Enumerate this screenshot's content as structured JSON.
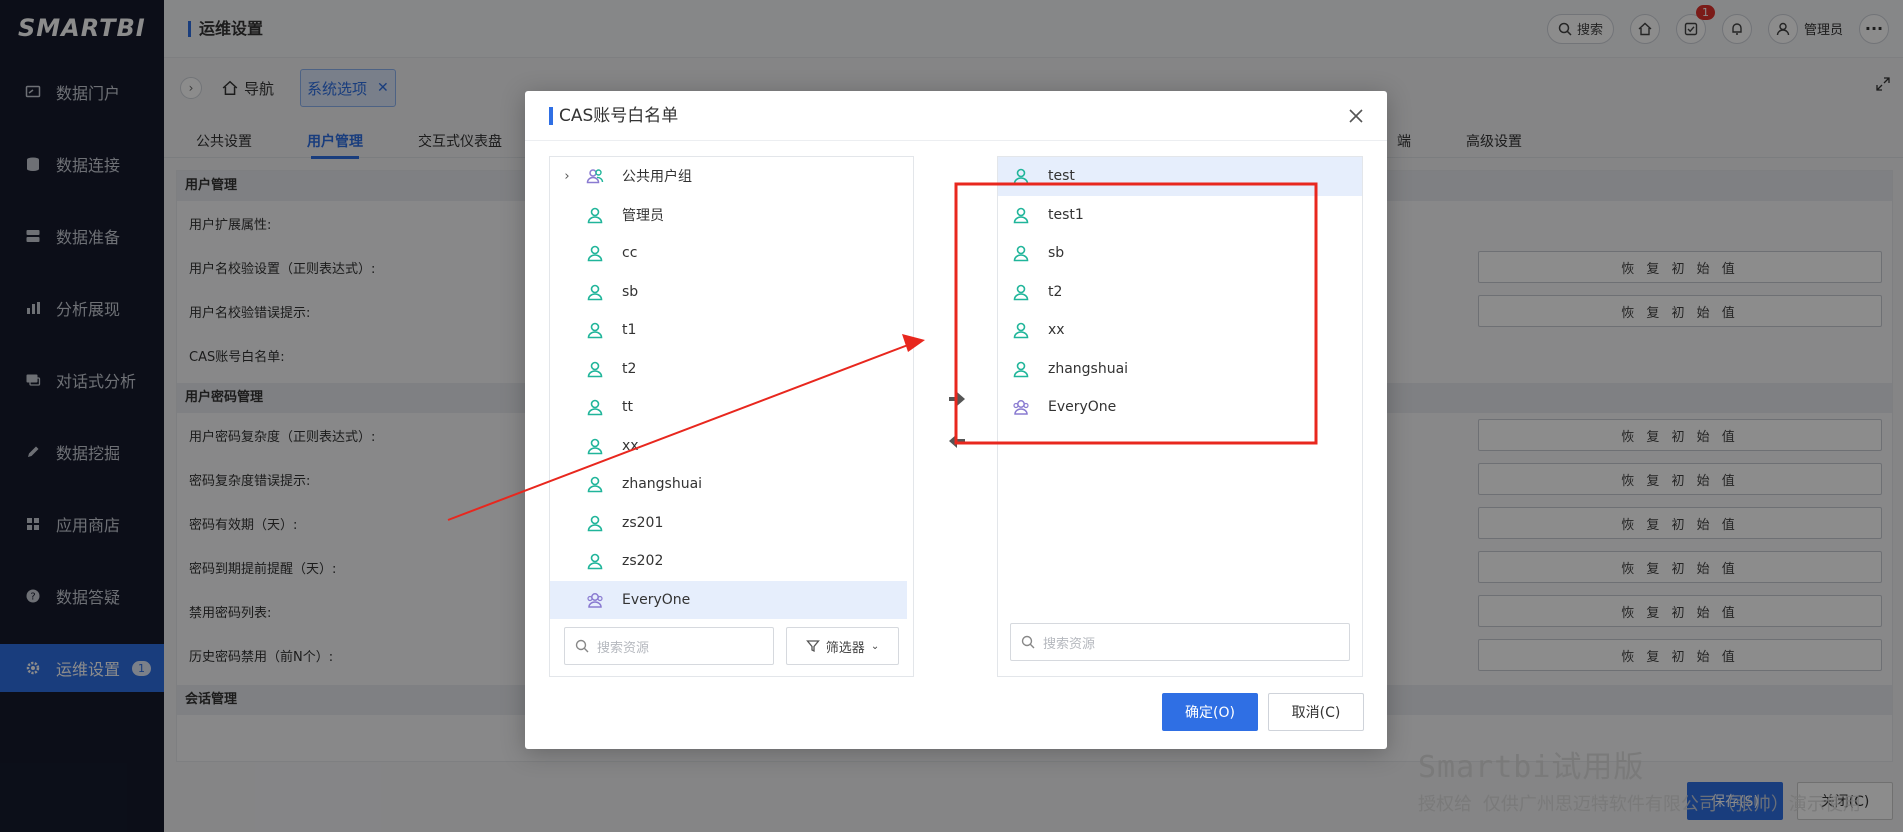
{
  "app": {
    "logo": "SMARTBI"
  },
  "sidebar": {
    "items": [
      {
        "label": "数据门户",
        "icon": "portal-icon"
      },
      {
        "label": "数据连接",
        "icon": "database-icon"
      },
      {
        "label": "数据准备",
        "icon": "server-icon"
      },
      {
        "label": "分析展现",
        "icon": "bar-chart-icon"
      },
      {
        "label": "对话式分析",
        "icon": "chat-icon"
      },
      {
        "label": "数据挖掘",
        "icon": "pen-icon"
      },
      {
        "label": "应用商店",
        "icon": "apps-icon"
      },
      {
        "label": "数据答疑",
        "icon": "question-icon"
      },
      {
        "label": "运维设置",
        "icon": "gear-icon",
        "badge": "1",
        "active": true
      }
    ]
  },
  "header": {
    "title": "运维设置",
    "search_label": "搜索",
    "task_badge": "1",
    "user_name": "管理员"
  },
  "subheader": {
    "nav_label": "导航",
    "open_tab": "系统选项"
  },
  "tabs": [
    "公共设置",
    "用户管理",
    "交互式仪表盘",
    "端",
    "高级设置"
  ],
  "settings": {
    "section_user": "用户管理",
    "rows_user": [
      "用户扩展属性:",
      "用户名校验设置（正则表达式）:",
      "用户名校验错误提示:",
      "CAS账号白名单:"
    ],
    "section_password": "用户密码管理",
    "rows_password": [
      "用户密码复杂度（正则表达式）:",
      "密码复杂度错误提示:",
      "密码有效期（天）:",
      "密码到期提前提醒（天）:",
      "禁用密码列表:",
      "历史密码禁用（前N个）:"
    ],
    "section_session": "会话管理",
    "reset_label": "恢 复 初 始 值"
  },
  "dialog": {
    "title": "CAS账号白名单",
    "left_list": [
      {
        "label": "公共用户组",
        "type": "group"
      },
      {
        "label": "管理员",
        "type": "user"
      },
      {
        "label": "cc",
        "type": "user"
      },
      {
        "label": "sb",
        "type": "user"
      },
      {
        "label": "t1",
        "type": "user"
      },
      {
        "label": "t2",
        "type": "user"
      },
      {
        "label": "tt",
        "type": "user"
      },
      {
        "label": "xx",
        "type": "user"
      },
      {
        "label": "zhangshuai",
        "type": "user"
      },
      {
        "label": "zs201",
        "type": "user"
      },
      {
        "label": "zs202",
        "type": "user"
      },
      {
        "label": "EveryOne",
        "type": "everyone",
        "selected": true
      }
    ],
    "right_list": [
      {
        "label": "test",
        "type": "user",
        "selected": true
      },
      {
        "label": "test1",
        "type": "user"
      },
      {
        "label": "sb",
        "type": "user"
      },
      {
        "label": "t2",
        "type": "user"
      },
      {
        "label": "xx",
        "type": "user"
      },
      {
        "label": "zhangshuai",
        "type": "user"
      },
      {
        "label": "EveryOne",
        "type": "everyone"
      }
    ],
    "search_placeholder": "搜索资源",
    "filter_label": "筛选器",
    "ok_label": "确定(O)",
    "cancel_label": "取消(C)"
  },
  "footer": {
    "save_label": "保存(S)",
    "close_label": "关闭(C)"
  },
  "watermark": {
    "title": "Smartbi试用版",
    "subtitle": "授权给 仅供广州思迈特软件有限公司（张帅）演示使用"
  },
  "colors": {
    "accent": "#2f6fe4",
    "sidebar_bg": "#161b2d",
    "user_icon": "#20b59a",
    "annotation": "#e8271e"
  }
}
